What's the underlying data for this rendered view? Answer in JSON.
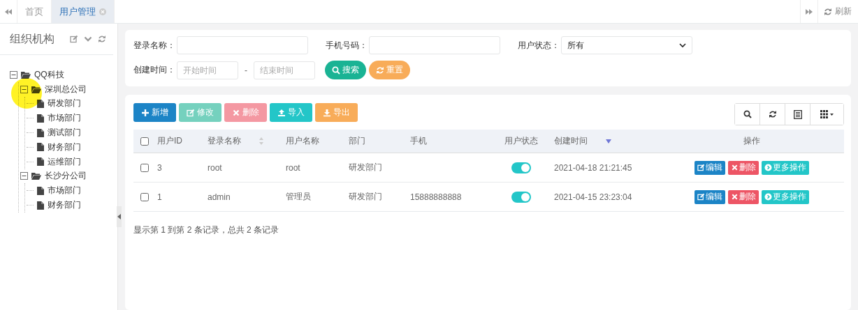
{
  "tabs": [
    {
      "label": "首页",
      "selected": false,
      "closable": false
    },
    {
      "label": "用户管理",
      "selected": true,
      "closable": true
    }
  ],
  "refresh_label": "刷新",
  "sidebar": {
    "title": "组织机构",
    "tree": [
      {
        "label": "QQ科技",
        "expanded": true,
        "children": [
          {
            "label": "深圳总公司",
            "expanded": true,
            "children": [
              {
                "label": "研发部门"
              },
              {
                "label": "市场部门"
              },
              {
                "label": "测试部门"
              },
              {
                "label": "财务部门"
              },
              {
                "label": "运维部门"
              }
            ]
          },
          {
            "label": "长沙分公司",
            "expanded": true,
            "children": [
              {
                "label": "市场部门"
              },
              {
                "label": "财务部门"
              }
            ]
          }
        ]
      }
    ]
  },
  "search": {
    "fields": [
      {
        "label": "登录名称：",
        "kind": "text"
      },
      {
        "label": "手机号码：",
        "kind": "text"
      },
      {
        "label": "用户状态：",
        "kind": "select",
        "value": "所有"
      }
    ],
    "date_range": {
      "label": "创建时间：",
      "start_placeholder": "开始时间",
      "separator": "-",
      "end_placeholder": "结束时间"
    },
    "buttons": [
      {
        "label": "搜索",
        "kind": "search"
      },
      {
        "label": "重置",
        "kind": "reset"
      }
    ]
  },
  "toolbar": [
    {
      "label": "新增",
      "kind": "add",
      "disabled": false
    },
    {
      "label": "修改",
      "kind": "edit",
      "disabled": true
    },
    {
      "label": "删除",
      "kind": "remove",
      "disabled": true
    },
    {
      "label": "导入",
      "kind": "import",
      "disabled": false
    },
    {
      "label": "导出",
      "kind": "export",
      "disabled": false
    }
  ],
  "table": {
    "select_all_checked": false,
    "columns": [
      {
        "kind": "check"
      },
      {
        "label": "用户ID",
        "kind": "text"
      },
      {
        "label": "登录名称",
        "kind": "text",
        "sortable": true,
        "sorted": false
      },
      {
        "label": "用户名称",
        "kind": "text"
      },
      {
        "label": "部门",
        "kind": "text"
      },
      {
        "label": "手机",
        "kind": "text"
      },
      {
        "label": "用户状态",
        "kind": "toggle"
      },
      {
        "label": "创建时间",
        "kind": "text",
        "sortable": true,
        "sorted": true
      },
      {
        "label": "操作",
        "kind": "actions"
      }
    ],
    "rows": [
      {
        "cells": [
          {
            "checked": false
          },
          "3",
          "root",
          "root",
          "研发部门",
          null,
          {
            "on": true
          },
          "2021-04-18 21:21:45",
          [
            {
              "label": "编辑",
              "kind": "edit"
            },
            {
              "label": "删除",
              "kind": "remove"
            },
            {
              "label": "更多操作",
              "kind": "more"
            }
          ]
        ]
      },
      {
        "cells": [
          {
            "checked": false
          },
          "1",
          "admin",
          "管理员",
          "研发部门",
          "15888888888",
          {
            "on": true
          },
          "2021-04-15 23:23:04",
          [
            {
              "label": "编辑",
              "kind": "edit"
            },
            {
              "label": "删除",
              "kind": "remove"
            },
            {
              "label": "更多操作",
              "kind": "more"
            }
          ]
        ]
      }
    ]
  },
  "pagination_info": "显示第 1 到第 2 条记录，总共 2 条记录"
}
